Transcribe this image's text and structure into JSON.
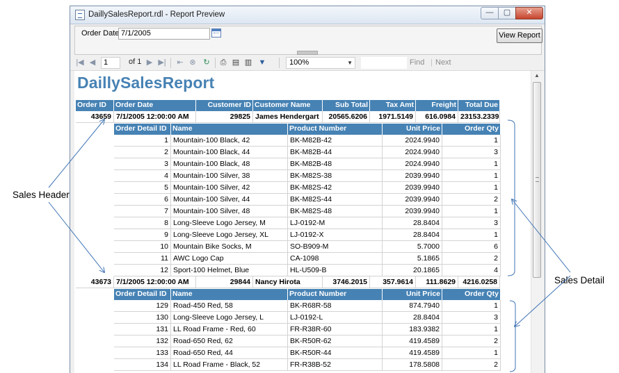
{
  "window": {
    "title": "DaillySalesReport.rdl - Report Preview",
    "min_symbol": "—",
    "max_symbol": "▢",
    "close_symbol": "✕"
  },
  "parameters": {
    "order_date_label": "Order Date",
    "order_date_value": "7/1/2005",
    "view_report_label": "View Report"
  },
  "toolbar": {
    "page_value": "1",
    "of_label": "of 1",
    "zoom_value": "100%",
    "find_label": "Find",
    "find_separator": "|",
    "next_label": "Next"
  },
  "report": {
    "title": "DaillySalesReport",
    "header_columns": [
      "Order ID",
      "Order Date",
      "Customer ID",
      "Customer Name",
      "Sub Total",
      "Tax Amt",
      "Freight",
      "Total Due"
    ],
    "detail_columns": [
      "Order Detail ID",
      "Name",
      "Product Number",
      "Unit Price",
      "Order Qty"
    ],
    "orders": [
      {
        "header": [
          "43659",
          "7/1/2005 12:00:00 AM",
          "29825",
          "James Hendergart",
          "20565.6206",
          "1971.5149",
          "616.0984",
          "23153.2339"
        ],
        "details": [
          [
            "1",
            "Mountain-100 Black, 42",
            "BK-M82B-42",
            "2024.9940",
            "1"
          ],
          [
            "2",
            "Mountain-100 Black, 44",
            "BK-M82B-44",
            "2024.9940",
            "3"
          ],
          [
            "3",
            "Mountain-100 Black, 48",
            "BK-M82B-48",
            "2024.9940",
            "1"
          ],
          [
            "4",
            "Mountain-100 Silver, 38",
            "BK-M82S-38",
            "2039.9940",
            "1"
          ],
          [
            "5",
            "Mountain-100 Silver, 42",
            "BK-M82S-42",
            "2039.9940",
            "1"
          ],
          [
            "6",
            "Mountain-100 Silver, 44",
            "BK-M82S-44",
            "2039.9940",
            "2"
          ],
          [
            "7",
            "Mountain-100 Silver, 48",
            "BK-M82S-48",
            "2039.9940",
            "1"
          ],
          [
            "8",
            "Long-Sleeve Logo Jersey, M",
            "LJ-0192-M",
            "28.8404",
            "3"
          ],
          [
            "9",
            "Long-Sleeve Logo Jersey, XL",
            "LJ-0192-X",
            "28.8404",
            "1"
          ],
          [
            "10",
            "Mountain Bike Socks, M",
            "SO-B909-M",
            "5.7000",
            "6"
          ],
          [
            "11",
            "AWC Logo Cap",
            "CA-1098",
            "5.1865",
            "2"
          ],
          [
            "12",
            "Sport-100 Helmet, Blue",
            "HL-U509-B",
            "20.1865",
            "4"
          ]
        ]
      },
      {
        "header": [
          "43673",
          "7/1/2005 12:00:00 AM",
          "29844",
          "Nancy Hirota",
          "3746.2015",
          "357.9614",
          "111.8629",
          "4216.0258"
        ],
        "details": [
          [
            "129",
            "Road-450 Red, 58",
            "BK-R68R-58",
            "874.7940",
            "1"
          ],
          [
            "130",
            "Long-Sleeve Logo Jersey, L",
            "LJ-0192-L",
            "28.8404",
            "3"
          ],
          [
            "131",
            "LL Road Frame - Red, 60",
            "FR-R38R-60",
            "183.9382",
            "1"
          ],
          [
            "132",
            "Road-650 Red, 62",
            "BK-R50R-62",
            "419.4589",
            "2"
          ],
          [
            "133",
            "Road-650 Red, 44",
            "BK-R50R-44",
            "419.4589",
            "1"
          ],
          [
            "134",
            "LL Road Frame - Black, 52",
            "FR-R38B-52",
            "178.5808",
            "2"
          ]
        ]
      }
    ]
  },
  "annotations": {
    "sales_header": "Sales Header",
    "sales_detail": "Sales Detail"
  },
  "colors": {
    "accent": "#4682b4"
  }
}
